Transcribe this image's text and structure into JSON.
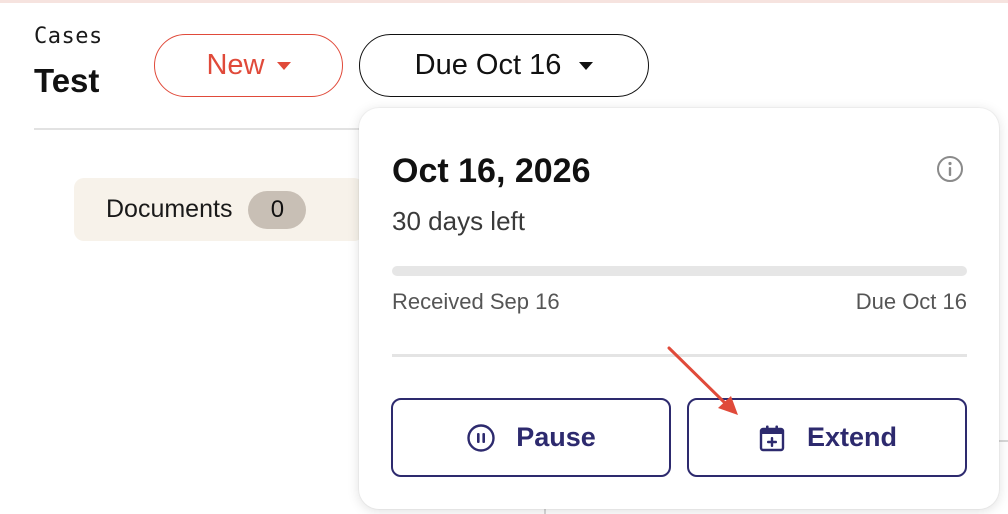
{
  "header": {
    "breadcrumb": "Cases",
    "title": "Test"
  },
  "status_dropdown": {
    "label": "New",
    "color": "#e04a3a",
    "icon": "caret-down-icon"
  },
  "due_dropdown": {
    "label": "Due Oct 16",
    "icon": "caret-down-icon"
  },
  "tabs": {
    "documents": {
      "label": "Documents",
      "count": "0"
    }
  },
  "popover": {
    "date": "Oct 16, 2026",
    "days_left": "30 days left",
    "info_icon": "info-icon",
    "progress_fraction": 0.0,
    "received": "Received Sep 16",
    "due": "Due Oct 16",
    "actions": {
      "pause": {
        "label": "Pause",
        "icon": "pause-circle-icon"
      },
      "extend": {
        "label": "Extend",
        "icon": "calendar-plus-icon"
      }
    },
    "accent_color": "#2d2a6e"
  },
  "annotation": {
    "arrow_color": "#e04a3a"
  }
}
